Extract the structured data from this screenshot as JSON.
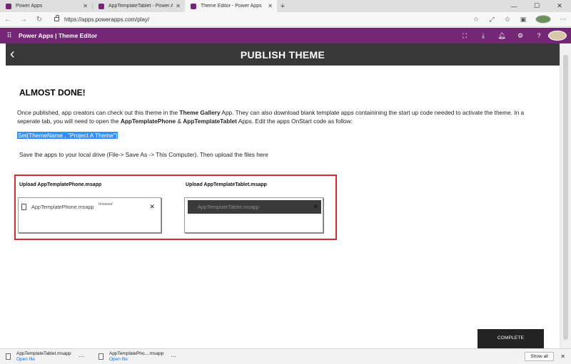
{
  "browser": {
    "tabs": [
      {
        "label": "Power Apps",
        "active": false
      },
      {
        "label": "AppTemplateTablet - Power Apps",
        "active": false
      },
      {
        "label": "Theme Editor - Power Apps",
        "active": true
      }
    ],
    "url": "https://apps.powerapps.com/play/"
  },
  "header": {
    "title": "Power Apps  |  Theme Editor",
    "brand_color": "#742774"
  },
  "app": {
    "bar_title": "PUBLISH THEME",
    "heading": "ALMOST DONE!",
    "para": {
      "p1": "Once published, app creators can check out this theme in the ",
      "b1": "Theme Gallery",
      "p2": " App. They can also download blank template apps containining the start up code needed to activate the theme. In a seperate tab, you will need to open the ",
      "b2": "AppTemplatePhone",
      "p3": " & ",
      "b3": "AppTemplateTablet",
      "p4": " Apps. Edit the apps OnStart code as follow:"
    },
    "code": "Set(ThemeName , \"Project A Theme\")",
    "save_text": "Save the apps to your local drive (File-> Save As -> This Computer).  Then upload the files here",
    "upload_phone": {
      "label": "Upload AppTemplatePhone.msapp",
      "file": "AppTemplatePhone.msapp",
      "status": "Unsaved"
    },
    "upload_tablet": {
      "label": "Upload AppTemplateTablet.msapp",
      "file": "AppTemplateTablet.msapp"
    },
    "complete_label": "COMPLETE"
  },
  "downloads": {
    "items": [
      {
        "name": "AppTemplateTablet.msapp",
        "action": "Open file"
      },
      {
        "name": "AppTemplatePho....msapp",
        "action": "Open file"
      }
    ],
    "show_all": "Show all"
  }
}
